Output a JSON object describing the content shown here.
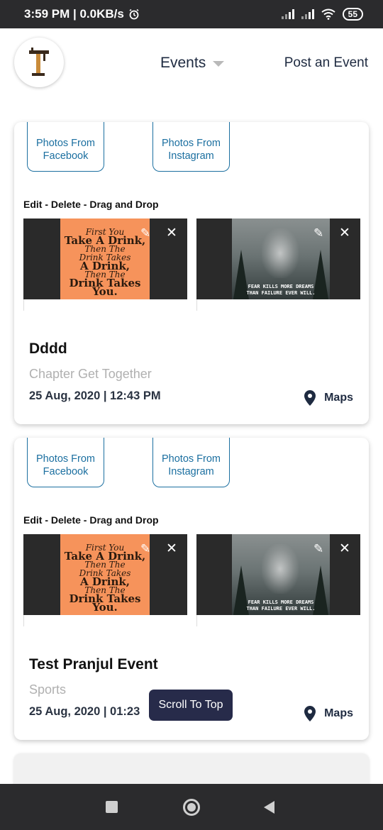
{
  "status_bar": {
    "time_net": "3:59 PM | 0.0KB/s",
    "battery": "55"
  },
  "header": {
    "dropdown_label": "Events",
    "post_event": "Post an Event"
  },
  "cards": [
    {
      "photo_facebook": [
        "Photos From",
        "Facebook"
      ],
      "photo_instagram": [
        "Photos From",
        "Instagram"
      ],
      "edit_caption": "Edit - Delete - Drag and Drop",
      "thumb1_lines": [
        "First You",
        "Take A Drink,",
        "Then The",
        "Drink Takes",
        "A Drink,",
        "Then The",
        "Drink Takes",
        "You."
      ],
      "thumb2_quote": [
        "FEAR KILLS MORE DREAMS",
        "THAN FAILURE EVER WILL."
      ],
      "title": "Dddd",
      "category": "Chapter Get Together",
      "date": "25 Aug, 2020  |  12:43 PM",
      "maps": "Maps"
    },
    {
      "photo_facebook": [
        "Photos From",
        "Facebook"
      ],
      "photo_instagram": [
        "Photos From",
        "Instagram"
      ],
      "edit_caption": "Edit - Delete - Drag and Drop",
      "thumb1_lines": [
        "First You",
        "Take A Drink,",
        "Then The",
        "Drink Takes",
        "A Drink,",
        "Then The",
        "Drink Takes",
        "You."
      ],
      "thumb2_quote": [
        "FEAR KILLS MORE DREAMS",
        "THAN FAILURE EVER WILL."
      ],
      "title": "Test Pranjul Event",
      "category": "Sports",
      "date": "25 Aug, 2020  |  01:23",
      "maps": "Maps"
    }
  ],
  "scroll_to_top": "Scroll To Top",
  "icons": {
    "alarm": "alarm-icon",
    "signal": "signal-icon",
    "wifi": "wifi-icon",
    "battery": "battery-icon",
    "logo": "logo-icon",
    "edit": "edit-icon",
    "close": "close-icon",
    "map_pin": "map-pin-icon"
  },
  "colors": {
    "accent_blue": "#1b6fa0",
    "navy": "#1e2a40",
    "toast": "#272b4a",
    "poster_orange": "#f6935b"
  }
}
